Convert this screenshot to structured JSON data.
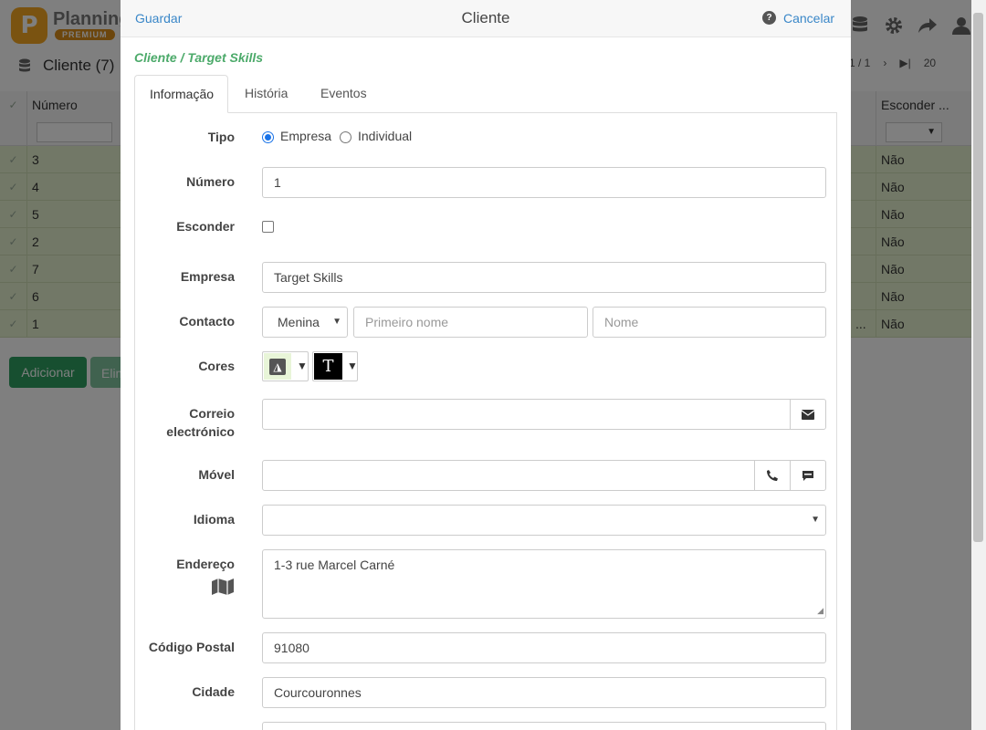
{
  "app": {
    "logo_letter": "P",
    "name": "Planning",
    "badge": "PREMIUM"
  },
  "list": {
    "title": "Cliente (7)",
    "pager": {
      "page": "1 / 1",
      "per_page": "20"
    },
    "columns": {
      "number": "Número",
      "hide": "Esconder ..."
    },
    "rows": [
      {
        "number": "3",
        "hide": "Não"
      },
      {
        "number": "4",
        "hide": "Não"
      },
      {
        "number": "5",
        "hide": "Não"
      },
      {
        "number": "2",
        "hide": "Não"
      },
      {
        "number": "7",
        "hide": "Não"
      },
      {
        "number": "6",
        "hide": "Não"
      },
      {
        "number": "1",
        "hide": "Não",
        "ellipsis": "..."
      }
    ],
    "add_label": "Adicionar",
    "delete_label": "Elim"
  },
  "modal": {
    "save_label": "Guardar",
    "title": "Cliente",
    "help_glyph": "?",
    "cancel_label": "Cancelar",
    "breadcrumb": "Cliente / Target Skills",
    "tabs": [
      "Informação",
      "História",
      "Eventos"
    ],
    "form": {
      "tipo_label": "Tipo",
      "tipo_options": [
        "Empresa",
        "Individual"
      ],
      "tipo_selected": "Empresa",
      "numero_label": "Número",
      "numero_value": "1",
      "esconder_label": "Esconder",
      "esconder_checked": false,
      "empresa_label": "Empresa",
      "empresa_value": "Target Skills",
      "contacto_label": "Contacto",
      "contacto_title": "Menina",
      "contacto_first_placeholder": "Primeiro nome",
      "contacto_last_placeholder": "Nome",
      "cores_label": "Cores",
      "correio_label_1": "Correio",
      "correio_label_2": "electrónico",
      "correio_value": "",
      "movel_label": "Móvel",
      "movel_value": "",
      "idioma_label": "Idioma",
      "idioma_value": "",
      "endereco_label": "Endereço",
      "endereco_value": "1-3 rue Marcel Carné",
      "codigo_label": "Código Postal",
      "codigo_value": "91080",
      "cidade_label": "Cidade",
      "cidade_value": "Courcouronnes"
    }
  },
  "colors": {
    "accent_green": "#2e9e61",
    "link_blue": "#3a87c8",
    "row_green": "#e5f0cf",
    "breadcrumb_green": "#4caa6a"
  }
}
